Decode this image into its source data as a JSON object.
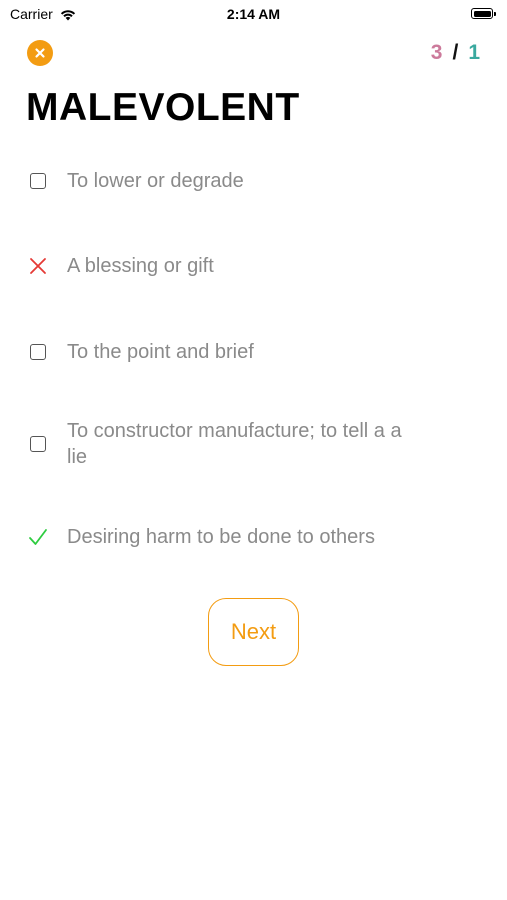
{
  "status_bar": {
    "carrier": "Carrier",
    "time": "2:14 AM"
  },
  "header": {
    "wrong_count": "3",
    "separator": "/",
    "right_count": "1"
  },
  "word": "MALEVOLENT",
  "options": [
    {
      "label": "To lower or degrade",
      "state": "unchecked"
    },
    {
      "label": "A blessing or gift",
      "state": "wrong"
    },
    {
      "label": "To the point and brief",
      "state": "unchecked"
    },
    {
      "label": "To constructor manufacture; to tell a a lie",
      "state": "unchecked"
    },
    {
      "label": "Desiring harm to be done to others",
      "state": "correct"
    }
  ],
  "next_label": "Next",
  "colors": {
    "accent": "#f39c12",
    "wrong": "#cc7a9b",
    "right": "#3aa99f",
    "wrong_mark": "#e53935",
    "correct_mark": "#2ecc40"
  }
}
